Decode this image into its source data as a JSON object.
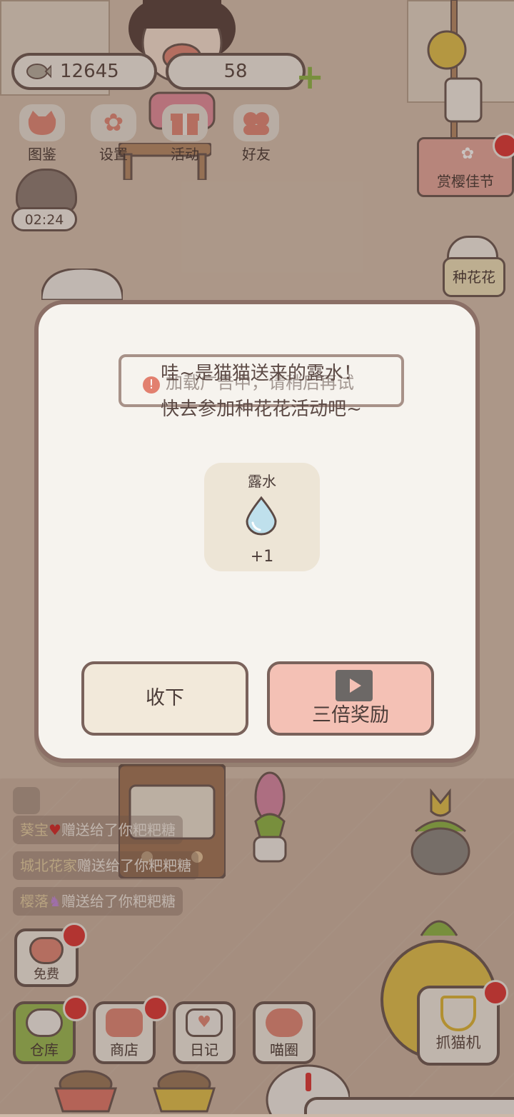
{
  "hud": {
    "fish_count": "12645",
    "gem_count": "58",
    "buttons": [
      {
        "label": "图鉴",
        "icon": "cat-book-icon"
      },
      {
        "label": "设置",
        "icon": "gear-icon"
      },
      {
        "label": "活动",
        "icon": "gift-icon"
      },
      {
        "label": "好友",
        "icon": "friends-icon"
      }
    ],
    "timer": "02:24"
  },
  "side": {
    "event_label": "赏樱佳节",
    "plant_label": "种花花"
  },
  "dialog": {
    "line1": "哇~是猫猫送来的露水！",
    "line1_overlay": "加载广告中，请稍后再试",
    "line2": "快去参加种花花活动吧~",
    "reward_name": "露水",
    "reward_amount": "+1",
    "accept_label": "收下",
    "triple_label": "三倍奖励"
  },
  "chat": [
    {
      "name": "葵宝",
      "text": "赠送给了你粑粑糖"
    },
    {
      "name": "城北花家",
      "text": "赠送给了你粑粑糖"
    },
    {
      "name": "樱落",
      "text": "赠送给了你粑粑糖"
    }
  ],
  "bottom": {
    "free_label": "免费",
    "items": [
      {
        "label": "仓库"
      },
      {
        "label": "商店"
      },
      {
        "label": "日记"
      },
      {
        "label": "喵圈"
      }
    ],
    "claw_label": "抓猫机"
  },
  "colors": {
    "accent_red": "#e03a3a",
    "accept_bg": "#f2e9da",
    "triple_bg": "#f4c1b5",
    "green": "#9bbd57"
  }
}
